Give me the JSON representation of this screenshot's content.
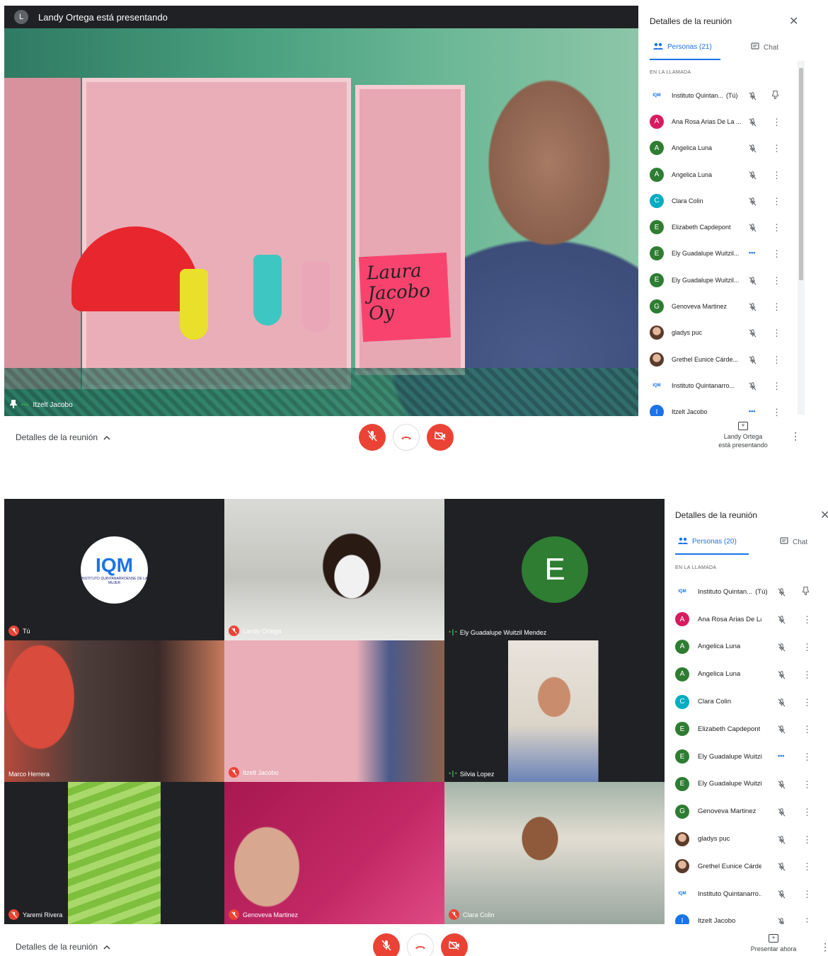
{
  "screen1": {
    "banner_initial": "L",
    "banner_text": "Landy Ortega está presentando",
    "sign_text": "Laura Jacobo Oy",
    "presenter_tile_name": "Itzelt Jacobo",
    "presenter_tile_dots": "•••",
    "details_label": "Detalles de la reunión",
    "presenting_line1": "Landy Ortega",
    "presenting_line2": "está presentando",
    "panel": {
      "title": "Detalles de la reunión",
      "tab_people": "Personas (21)",
      "tab_chat": "Chat",
      "section": "EN LA LLAMADA",
      "people": [
        {
          "initial": "IQM",
          "name": "Instituto Quintan...",
          "suffix": "(Tú)",
          "kind": "logo",
          "status": "muted",
          "action": "pin"
        },
        {
          "initial": "A",
          "name": "Ana Rosa Arias De La ...",
          "suffix": "",
          "kind": "pink",
          "status": "muted",
          "action": "dots"
        },
        {
          "initial": "A",
          "name": "Angelica Luna",
          "suffix": "",
          "kind": "green",
          "status": "muted",
          "action": "dots"
        },
        {
          "initial": "A",
          "name": "Angelica Luna",
          "suffix": "",
          "kind": "green",
          "status": "muted",
          "action": "dots"
        },
        {
          "initial": "C",
          "name": "Clara Colin",
          "suffix": "",
          "kind": "teal",
          "status": "muted",
          "action": "dots"
        },
        {
          "initial": "E",
          "name": "Elizabeth Capdepont",
          "suffix": "",
          "kind": "green",
          "status": "muted",
          "action": "dots"
        },
        {
          "initial": "E",
          "name": "Ely Guadalupe Wuitzil...",
          "suffix": "",
          "kind": "green",
          "status": "speaking",
          "action": "dots"
        },
        {
          "initial": "E",
          "name": "Ely Guadalupe Wuitzil...",
          "suffix": "",
          "kind": "green",
          "status": "muted",
          "action": "dots"
        },
        {
          "initial": "G",
          "name": "Genoveva Martinez",
          "suffix": "",
          "kind": "green",
          "status": "muted",
          "action": "dots"
        },
        {
          "initial": "",
          "name": "gladys puc",
          "suffix": "",
          "kind": "photo",
          "status": "muted",
          "action": "dots"
        },
        {
          "initial": "",
          "name": "Grethel Eunice Cárde...",
          "suffix": "",
          "kind": "photo",
          "status": "muted",
          "action": "dots"
        },
        {
          "initial": "IQM",
          "name": "Instituto Quintanarro...",
          "suffix": "",
          "kind": "logo",
          "status": "muted",
          "action": "dots"
        },
        {
          "initial": "I",
          "name": "Itzelt Jacobo",
          "suffix": "",
          "kind": "blue",
          "status": "speaking",
          "action": "dots"
        }
      ]
    }
  },
  "screen2": {
    "tiles": [
      {
        "name": "Tú",
        "indicator": "muted",
        "kind": "logo"
      },
      {
        "name": "Landy Ortega",
        "indicator": "muted",
        "kind": "video-mask"
      },
      {
        "name": "Ely Guadalupe Wuitzil Mendez",
        "indicator": "speaking",
        "kind": "avatar"
      },
      {
        "name": "Marco Herrera",
        "indicator": "none",
        "kind": "video-jewelry"
      },
      {
        "name": "Itzelt Jacobo",
        "indicator": "muted",
        "kind": "video-cabinet"
      },
      {
        "name": "Silvia Lopez",
        "indicator": "speaking",
        "kind": "video-woman"
      },
      {
        "name": "Yaremi Rivera",
        "indicator": "muted",
        "kind": "video-green"
      },
      {
        "name": "Genoveva Martinez",
        "indicator": "muted",
        "kind": "video-glasses"
      },
      {
        "name": "Clara Colin",
        "indicator": "muted",
        "kind": "video-table"
      }
    ],
    "logo_big": "IQM",
    "logo_small": "INSTITUTO QUINTANARROENSE DE LA MUJER",
    "avatar_initial": "E",
    "details_label": "Detalles de la reunión",
    "present_now": "Presentar ahora",
    "panel": {
      "title": "Detalles de la reunión",
      "tab_people": "Personas (20)",
      "tab_chat": "Chat",
      "section": "EN LA LLAMADA",
      "people": [
        {
          "initial": "IQM",
          "name": "Instituto Quintan...",
          "suffix": "(Tú)",
          "kind": "logo",
          "status": "muted",
          "action": "pin"
        },
        {
          "initial": "A",
          "name": "Ana Rosa Arias De La ...",
          "suffix": "",
          "kind": "pink",
          "status": "muted",
          "action": "dots"
        },
        {
          "initial": "A",
          "name": "Angelica Luna",
          "suffix": "",
          "kind": "green",
          "status": "muted",
          "action": "dots"
        },
        {
          "initial": "A",
          "name": "Angelica Luna",
          "suffix": "",
          "kind": "green",
          "status": "muted",
          "action": "dots"
        },
        {
          "initial": "C",
          "name": "Clara Colin",
          "suffix": "",
          "kind": "teal",
          "status": "muted",
          "action": "dots"
        },
        {
          "initial": "E",
          "name": "Elizabeth Capdepont",
          "suffix": "",
          "kind": "green",
          "status": "muted",
          "action": "dots"
        },
        {
          "initial": "E",
          "name": "Ely Guadalupe Wuitzil...",
          "suffix": "",
          "kind": "green",
          "status": "speaking",
          "action": "dots"
        },
        {
          "initial": "E",
          "name": "Ely Guadalupe Wuitzil...",
          "suffix": "",
          "kind": "green",
          "status": "muted",
          "action": "dots"
        },
        {
          "initial": "G",
          "name": "Genoveva Martinez",
          "suffix": "",
          "kind": "green",
          "status": "muted",
          "action": "dots"
        },
        {
          "initial": "",
          "name": "gladys puc",
          "suffix": "",
          "kind": "photo",
          "status": "muted",
          "action": "dots"
        },
        {
          "initial": "",
          "name": "Grethel Eunice Cárde...",
          "suffix": "",
          "kind": "photo",
          "status": "muted",
          "action": "dots"
        },
        {
          "initial": "IQM",
          "name": "Instituto Quintanarro...",
          "suffix": "",
          "kind": "logo",
          "status": "muted",
          "action": "dots"
        },
        {
          "initial": "I",
          "name": "Itzelt Jacobo",
          "suffix": "",
          "kind": "blue",
          "status": "muted",
          "action": "dots"
        }
      ]
    }
  },
  "colors": {
    "muted_red": "#ea4335",
    "active_blue": "#1a73e8",
    "speaking_green": "#34a853",
    "dark_bg": "#202124",
    "avatar_green": "#2e7d32",
    "avatar_pink": "#d81b60",
    "avatar_teal": "#00acc1",
    "avatar_blue": "#1a73e8"
  },
  "icons": {
    "mic_off": "mic-off-icon",
    "hangup": "hangup-icon",
    "cam_off": "camera-off-icon",
    "close": "close-icon",
    "people": "people-icon",
    "chat": "chat-icon",
    "pin": "pin-icon",
    "more": "more-vert-icon",
    "chevron_up": "chevron-up-icon",
    "present": "present-icon"
  }
}
